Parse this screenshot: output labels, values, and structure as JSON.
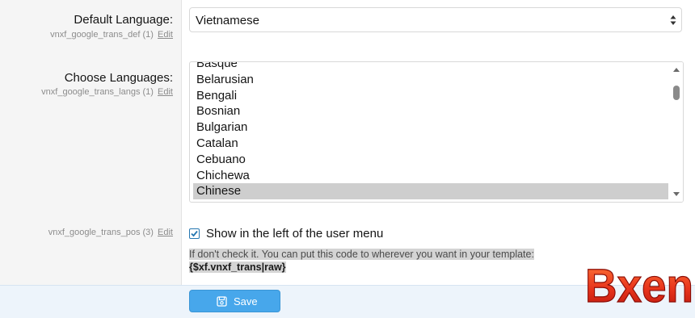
{
  "settings": {
    "default_language": {
      "label": "Default Language:",
      "hint": "vnxf_google_trans_def (1)",
      "edit": "Edit",
      "value": "Vietnamese"
    },
    "choose_languages": {
      "label": "Choose Languages:",
      "hint": "vnxf_google_trans_langs (1)",
      "edit": "Edit",
      "options": [
        "Basque",
        "Belarusian",
        "Bengali",
        "Bosnian",
        "Bulgarian",
        "Catalan",
        "Cebuano",
        "Chichewa",
        "Chinese"
      ],
      "selected": "Chinese"
    },
    "trans_pos": {
      "hint": "vnxf_google_trans_pos (3)",
      "edit": "Edit",
      "checkbox_label": "Show in the left of the user menu",
      "checked": true,
      "explain": "If don't check it. You can put this code to wherever you want in your template:",
      "code": "{$xf.vnxf_trans|raw}"
    }
  },
  "footer": {
    "save_label": "Save"
  },
  "watermark": {
    "text": "Bxen"
  },
  "colors": {
    "accent": "#47a7eb",
    "checkbox": "#2577b1"
  }
}
